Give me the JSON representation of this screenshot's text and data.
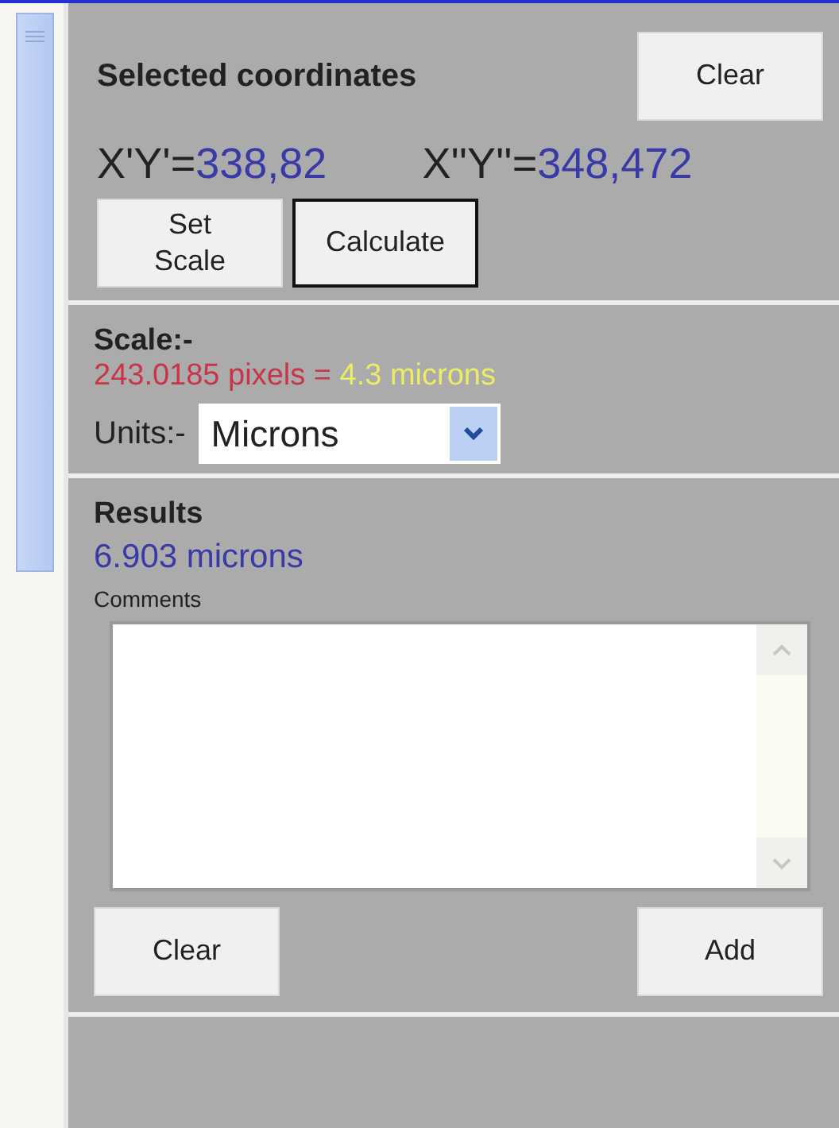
{
  "coordinates": {
    "title": "Selected coordinates",
    "clear_button": "Clear",
    "points": [
      {
        "label": "X'Y'=",
        "value": "338,82"
      },
      {
        "label": "X''Y''=",
        "value": "348,472"
      }
    ],
    "buttons": [
      {
        "label": "Set Scale",
        "selected": false
      },
      {
        "label": "Calculate",
        "selected": true
      }
    ]
  },
  "scale": {
    "title": "Scale:-",
    "pixels": "243.0185 pixels =",
    "length": "4.3 microns",
    "units_label": "Units:-",
    "units_value": "Microns"
  },
  "results": {
    "title": "Results",
    "value": "6.903 microns",
    "comments_label": "Comments",
    "clear_button": "Clear",
    "add_button": "Add"
  }
}
